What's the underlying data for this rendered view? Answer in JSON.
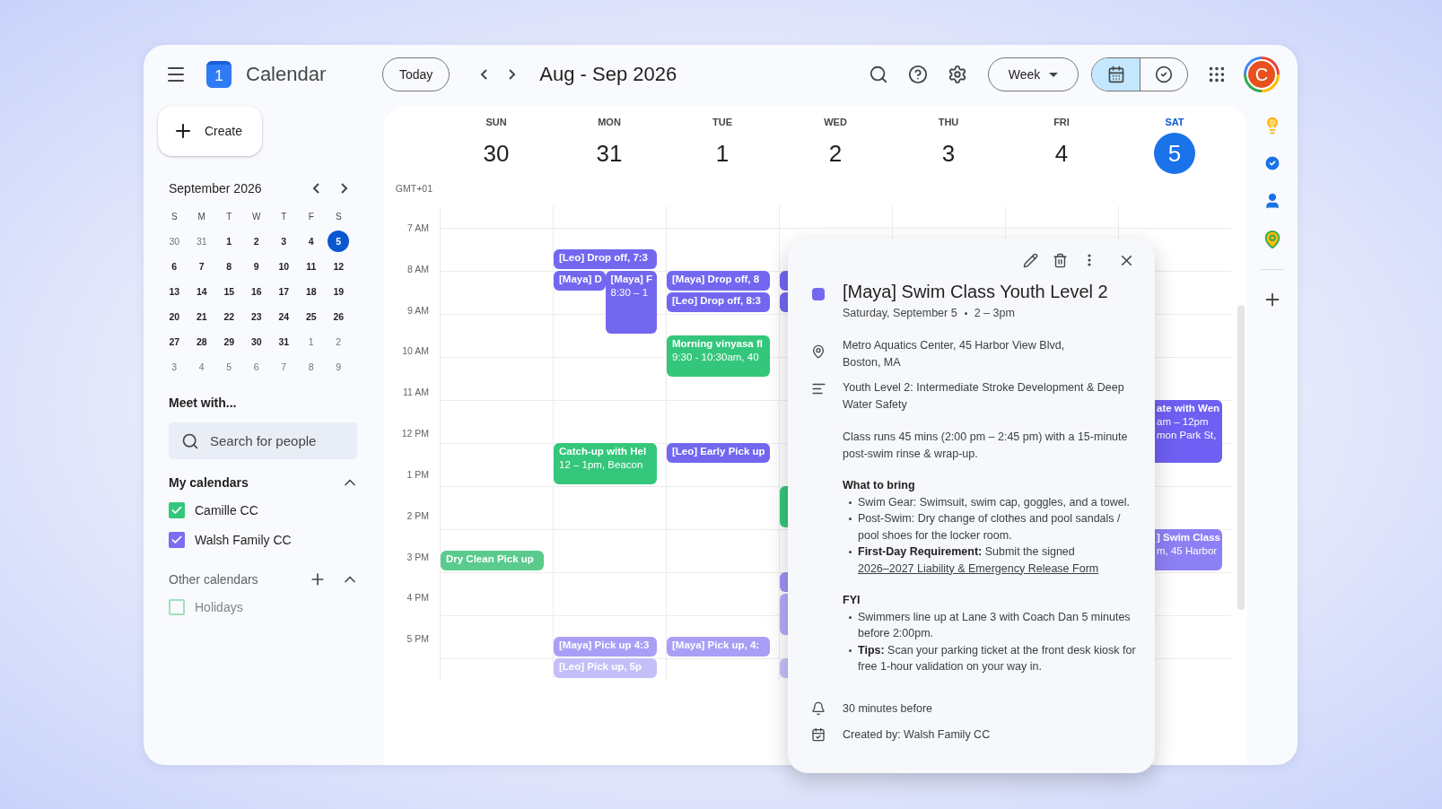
{
  "app": {
    "title": "Calendar",
    "logo_day": "1"
  },
  "header": {
    "today": "Today",
    "range": "Aug - Sep 2026",
    "view": "Week",
    "avatar": "C",
    "views": [
      {
        "kind": "calendar",
        "selected": true
      },
      {
        "kind": "tasks",
        "selected": false
      }
    ]
  },
  "create": "Create",
  "mini_calendar": {
    "title": "September 2026",
    "weekdays": [
      "S",
      "M",
      "T",
      "W",
      "T",
      "F",
      "S"
    ],
    "days": [
      {
        "label": "30",
        "muted": true,
        "selected": false
      },
      {
        "label": "31",
        "muted": true,
        "selected": false
      },
      {
        "label": "1",
        "muted": false,
        "selected": false
      },
      {
        "label": "2",
        "muted": false,
        "selected": false
      },
      {
        "label": "3",
        "muted": false,
        "selected": false
      },
      {
        "label": "4",
        "muted": false,
        "selected": false
      },
      {
        "label": "5",
        "muted": false,
        "selected": true
      },
      {
        "label": "6",
        "muted": false,
        "selected": false
      },
      {
        "label": "7",
        "muted": false,
        "selected": false
      },
      {
        "label": "8",
        "muted": false,
        "selected": false
      },
      {
        "label": "9",
        "muted": false,
        "selected": false
      },
      {
        "label": "10",
        "muted": false,
        "selected": false
      },
      {
        "label": "11",
        "muted": false,
        "selected": false
      },
      {
        "label": "12",
        "muted": false,
        "selected": false
      },
      {
        "label": "13",
        "muted": false,
        "selected": false
      },
      {
        "label": "14",
        "muted": false,
        "selected": false
      },
      {
        "label": "15",
        "muted": false,
        "selected": false
      },
      {
        "label": "16",
        "muted": false,
        "selected": false
      },
      {
        "label": "17",
        "muted": false,
        "selected": false
      },
      {
        "label": "18",
        "muted": false,
        "selected": false
      },
      {
        "label": "19",
        "muted": false,
        "selected": false
      },
      {
        "label": "20",
        "muted": false,
        "selected": false
      },
      {
        "label": "21",
        "muted": false,
        "selected": false
      },
      {
        "label": "22",
        "muted": false,
        "selected": false
      },
      {
        "label": "23",
        "muted": false,
        "selected": false
      },
      {
        "label": "24",
        "muted": false,
        "selected": false
      },
      {
        "label": "25",
        "muted": false,
        "selected": false
      },
      {
        "label": "26",
        "muted": false,
        "selected": false
      },
      {
        "label": "27",
        "muted": false,
        "selected": false
      },
      {
        "label": "28",
        "muted": false,
        "selected": false
      },
      {
        "label": "29",
        "muted": false,
        "selected": false
      },
      {
        "label": "30",
        "muted": false,
        "selected": false
      },
      {
        "label": "31",
        "muted": false,
        "selected": false
      },
      {
        "label": "1",
        "muted": true,
        "selected": false
      },
      {
        "label": "2",
        "muted": true,
        "selected": false
      },
      {
        "label": "3",
        "muted": true,
        "selected": false
      },
      {
        "label": "4",
        "muted": true,
        "selected": false
      },
      {
        "label": "5",
        "muted": true,
        "selected": false
      },
      {
        "label": "6",
        "muted": true,
        "selected": false
      },
      {
        "label": "7",
        "muted": true,
        "selected": false
      },
      {
        "label": "8",
        "muted": true,
        "selected": false
      },
      {
        "label": "9",
        "muted": true,
        "selected": false
      }
    ]
  },
  "meet": {
    "title": "Meet with...",
    "placeholder": "Search for people"
  },
  "my_calendars": {
    "title": "My calendars",
    "expanded": true,
    "items": [
      {
        "name": "Camille CC",
        "checked": true,
        "color": "#34c77b"
      },
      {
        "name": "Walsh Family CC",
        "checked": true,
        "color": "#7b6cf0"
      }
    ]
  },
  "other_calendars": {
    "title": "Other calendars",
    "expanded": true,
    "items": [
      {
        "name": "Holidays",
        "checked": false,
        "color": "#9fe0bb"
      }
    ]
  },
  "timezone": "GMT+01",
  "hours": [
    "7 AM",
    "8 AM",
    "9 AM",
    "10 AM",
    "11 AM",
    "12 PM",
    "1 PM",
    "2 PM",
    "3 PM",
    "4 PM",
    "5 PM"
  ],
  "days": [
    {
      "name": "SUN",
      "date": "30",
      "selected": false,
      "events": [
        {
          "kind": "fourhourgap"
        },
        {
          "kind": "fourhourgap"
        },
        {
          "kind": "short",
          "title": "Dry Clean Pick up",
          "color": "#5acb8c"
        }
      ]
    },
    {
      "name": "MON",
      "date": "31",
      "selected": false,
      "events": [
        {
          "kind": "hourgap"
        },
        {
          "kind": "short",
          "title": "[Leo] Drop off, 7:3",
          "color": "#7367f0"
        },
        {
          "kind": "group",
          "events": [
            {
              "kind": "short",
              "title": "[Maya] D",
              "color": "#7367f0"
            },
            {
              "kind": "long",
              "title": "[Maya] F",
              "detail": "8:30 – 1",
              "color": "#7367f0"
            }
          ]
        },
        {
          "kind": "twohourgap"
        },
        {
          "kind": "gap"
        },
        {
          "kind": "hour",
          "title": "Catch-up with Hel",
          "detail": "12 – 1pm, Beacon",
          "color": "#34c77b"
        },
        {
          "kind": "threehourgap"
        },
        {
          "kind": "gap"
        },
        {
          "kind": "short",
          "title": "[Maya] Pick up 4:3",
          "color": "#a99ff6"
        },
        {
          "kind": "short",
          "title": "[Leo] Pick up, 5p",
          "color": "#c5bff9"
        }
      ]
    },
    {
      "name": "TUE",
      "date": "1",
      "selected": false,
      "events": [
        {
          "kind": "longgap"
        },
        {
          "kind": "short",
          "title": "[Maya] Drop off, 8",
          "color": "#7367f0"
        },
        {
          "kind": "short",
          "title": "[Leo] Drop off, 8:3",
          "color": "#7367f0"
        },
        {
          "kind": "gap"
        },
        {
          "kind": "hour",
          "title": "Morning vinyasa fl",
          "detail": "9:30 - 10:30am, 40",
          "color": "#34c77b"
        },
        {
          "kind": "longgap"
        },
        {
          "kind": "short",
          "title": "[Leo] Early Pick up",
          "color": "#7367f0"
        },
        {
          "kind": "fourhourgap"
        },
        {
          "kind": "short",
          "title": "[Maya] Pick up, 4:",
          "color": "#a99ff6"
        }
      ]
    },
    {
      "name": "WED",
      "date": "2",
      "selected": false,
      "events": [
        {
          "kind": "longgap"
        },
        {
          "kind": "short",
          "color": "#7367f0"
        },
        {
          "kind": "short",
          "color": "#7367f0"
        },
        {
          "kind": "fourhourgap"
        },
        {
          "kind": "hour",
          "color": "#34c77b"
        },
        {
          "kind": "hourgap"
        },
        {
          "kind": "short",
          "color": "#9d92f5"
        },
        {
          "kind": "hour",
          "color": "#b3abf7"
        },
        {
          "kind": "gap"
        },
        {
          "kind": "short",
          "color": "#c5bff9"
        }
      ]
    },
    {
      "name": "THU",
      "date": "3",
      "selected": false
    },
    {
      "name": "FRI",
      "date": "4",
      "selected": false
    },
    {
      "name": "SAT",
      "date": "5",
      "selected": true,
      "events": [
        {
          "kind": "fourhourgap"
        },
        {
          "kind": "gap"
        },
        {
          "kind": "coveredlong",
          "title": "ate with Wen",
          "detail": "am – 12pm",
          "extra": "mon Park St,",
          "color": "#6f5ff2"
        },
        {
          "kind": "longgap"
        },
        {
          "kind": "coveredhour",
          "title": "] Swim Class",
          "detail": "m, 45 Harbor",
          "color": "#8d80f5"
        }
      ]
    }
  ],
  "popup": {
    "title": "[Maya] Swim Class Youth Level 2",
    "color": "#7367f0",
    "date": "Saturday, September 5",
    "time": "2 – 3pm",
    "location": [
      "Metro Aquatics Center, 45 Harbor View Blvd,",
      "Boston, MA"
    ],
    "summary": "Youth Level 2: Intermediate Stroke Development & Deep Water Safety",
    "notes": "Class runs 45 mins (2:00 pm – 2:45 pm) with a 15-minute post-swim rinse & wrap-up.",
    "sections": [
      {
        "heading": "What to bring",
        "bullets": [
          {
            "text": "Swim Gear: Swimsuit, swim cap, goggles, and a towel."
          },
          {
            "text": "Post-Swim: Dry change of clothes and pool sandals / pool shoes for the locker room."
          },
          {
            "text": "**First-Day Requirement:** Submit the signed",
            "link": "2026–2027 Liability & Emergency Release Form"
          }
        ]
      },
      {
        "heading": "FYI",
        "bullets": [
          {
            "text": "Swimmers line up at Lane 3 with Coach Dan 5 minutes before 2:00pm."
          },
          {
            "text": "**Tips:** Scan your parking ticket at the front desk kiosk for free 1-hour validation on your way in."
          }
        ]
      }
    ],
    "reminder": "30 minutes before",
    "creator": "Created by: Walsh Family CC"
  }
}
